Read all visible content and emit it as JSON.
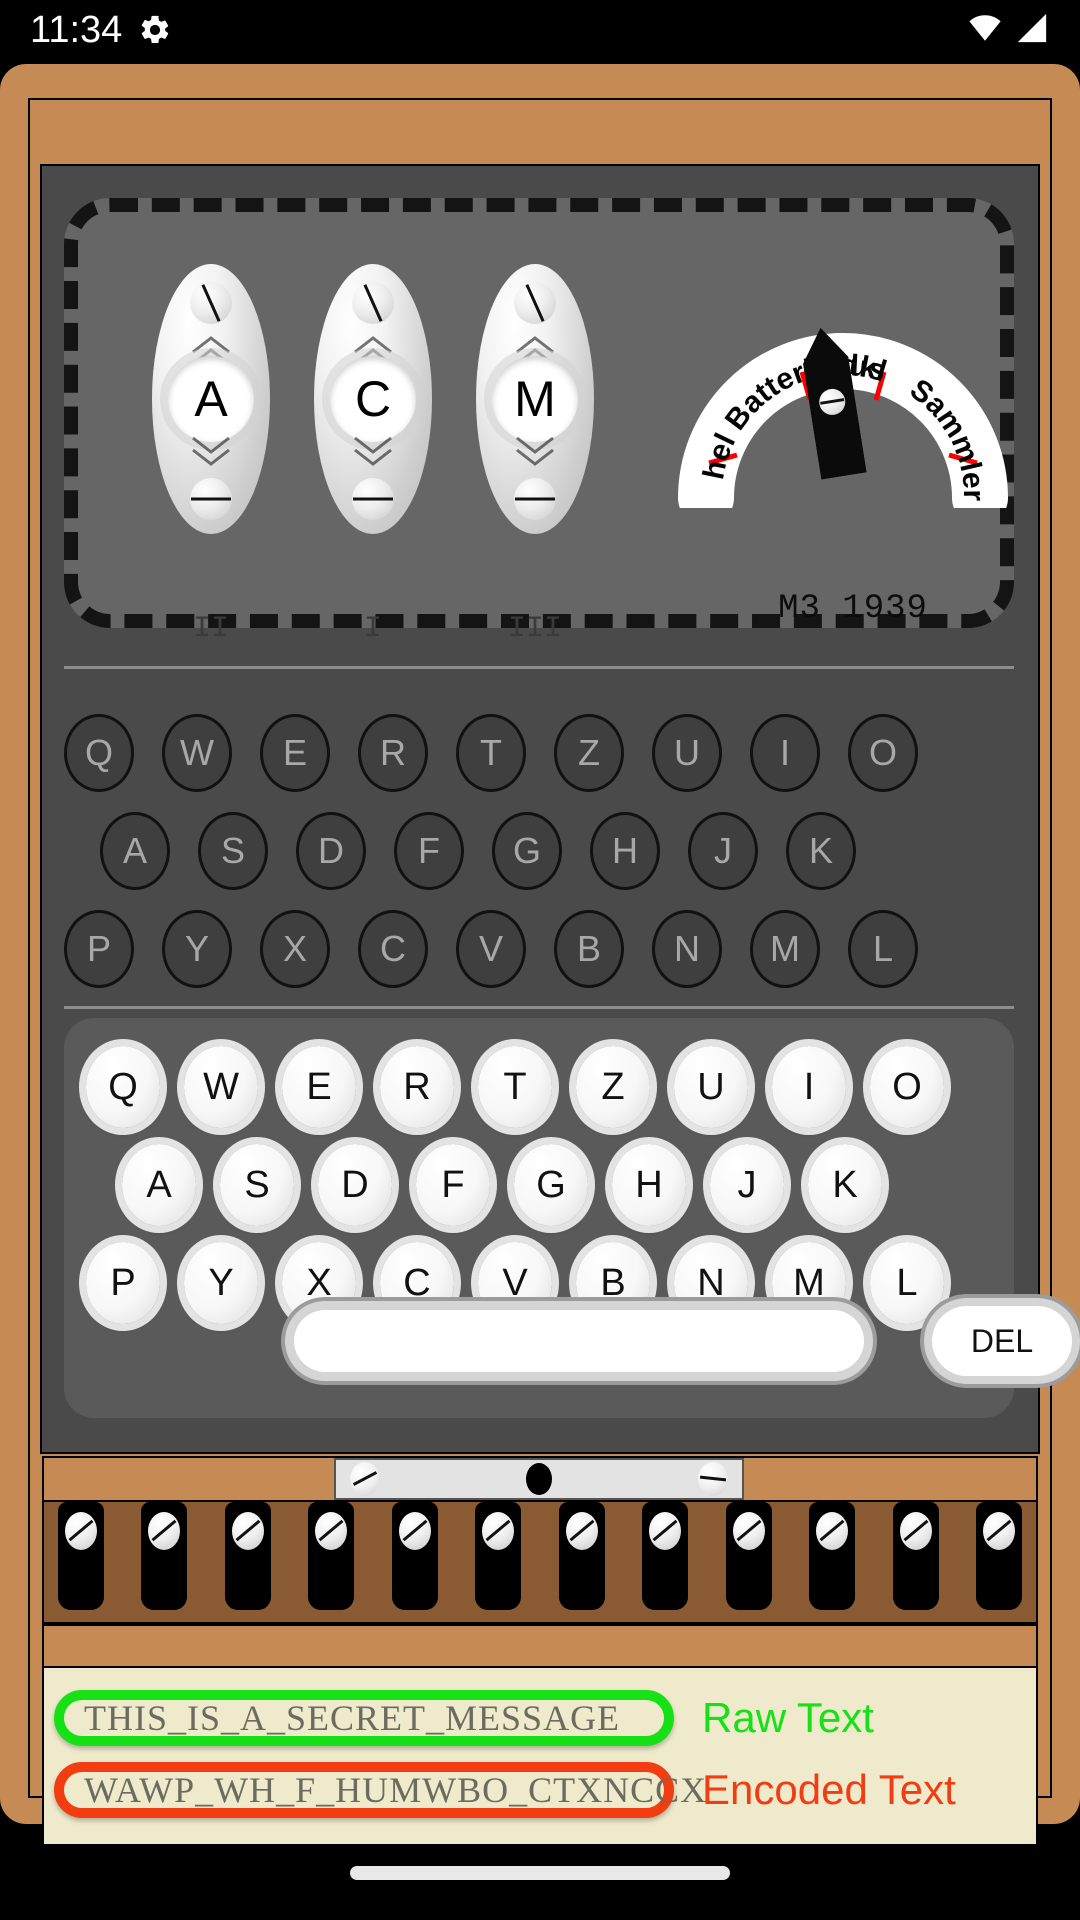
{
  "statusbar": {
    "time": "11:34",
    "gear_icon": "gear-icon",
    "wifi_icon": "wifi-icon",
    "signal_icon": "signal-icon"
  },
  "machine": {
    "model_label": "M3  1939",
    "rotors": [
      {
        "letter": "A",
        "roman": "II"
      },
      {
        "letter": "C",
        "roman": "I"
      },
      {
        "letter": "M",
        "roman": "III"
      }
    ],
    "dial": {
      "labels": [
        "hel",
        "Batterie",
        "dkl",
        "aus",
        "Sammler"
      ],
      "tick_color": "#ff0000",
      "pointer_color": "#0b0b0b"
    },
    "lampboard": {
      "rows": [
        [
          "Q",
          "W",
          "E",
          "R",
          "T",
          "Z",
          "U",
          "I",
          "O"
        ],
        [
          "A",
          "S",
          "D",
          "F",
          "G",
          "H",
          "J",
          "K"
        ],
        [
          "P",
          "Y",
          "X",
          "C",
          "V",
          "B",
          "N",
          "M",
          "L"
        ]
      ]
    },
    "keyboard": {
      "rows": [
        [
          "Q",
          "W",
          "E",
          "R",
          "T",
          "Z",
          "U",
          "I",
          "O"
        ],
        [
          "A",
          "S",
          "D",
          "F",
          "G",
          "H",
          "J",
          "K"
        ],
        [
          "P",
          "Y",
          "X",
          "C",
          "V",
          "B",
          "N",
          "M",
          "L"
        ]
      ],
      "space_label": "",
      "del_label": "DEL"
    },
    "plugboard": {
      "plug_count": 12,
      "plate_dot": "black-oval"
    }
  },
  "output": {
    "raw": {
      "value": "THIS_IS_A_SECRET_MESSAGE",
      "label": "Raw  Text",
      "color": "#16e016"
    },
    "encoded": {
      "value": "WAWP_WH_F_HUMWBO_CTXNCCX",
      "label": "Encoded  Text",
      "color": "#f23c12"
    }
  },
  "colors": {
    "wood": "#c68a55",
    "panel": "#4a4a4a",
    "rotor_box": "#666666",
    "plug_wood": "#8a5a32",
    "paper": "#eeeacb"
  }
}
